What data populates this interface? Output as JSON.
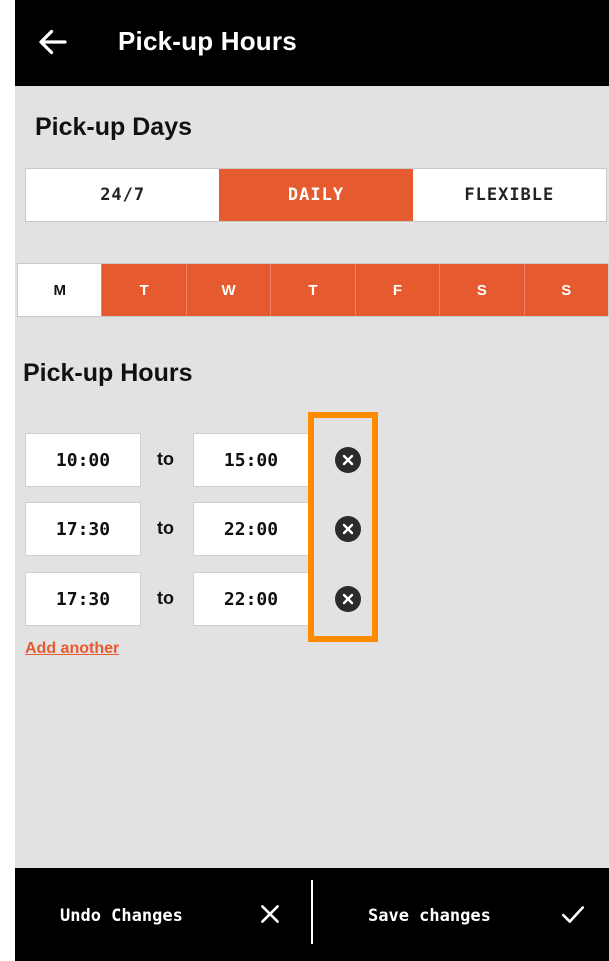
{
  "header": {
    "title": "Pick-up Hours",
    "back_icon": "arrow-left-icon"
  },
  "pickup_days": {
    "title": "Pick-up Days",
    "modes": [
      {
        "label": "24/7",
        "selected": false
      },
      {
        "label": "DAILY",
        "selected": true
      },
      {
        "label": "FLEXIBLE",
        "selected": false
      }
    ],
    "weekdays": [
      {
        "label": "M",
        "selected": false
      },
      {
        "label": "T",
        "selected": true
      },
      {
        "label": "W",
        "selected": true
      },
      {
        "label": "T",
        "selected": true
      },
      {
        "label": "F",
        "selected": true
      },
      {
        "label": "S",
        "selected": true
      },
      {
        "label": "S",
        "selected": true
      }
    ]
  },
  "pickup_hours": {
    "title": "Pick-up Hours",
    "separator": "to",
    "ranges": [
      {
        "from": "10:00",
        "to": "15:00"
      },
      {
        "from": "17:30",
        "to": "22:00"
      },
      {
        "from": "17:30",
        "to": "22:00"
      }
    ],
    "remove_icon": "close-circle-icon",
    "add_label": "Add another"
  },
  "footer": {
    "undo_label": "Undo Changes",
    "undo_icon": "close-icon",
    "save_label": "Save changes",
    "save_icon": "checkmark-icon"
  },
  "colors": {
    "accent": "#e65a2f",
    "highlight": "#ff8c00",
    "bar_background": "#000000",
    "screen_background": "#e2e2e2"
  }
}
